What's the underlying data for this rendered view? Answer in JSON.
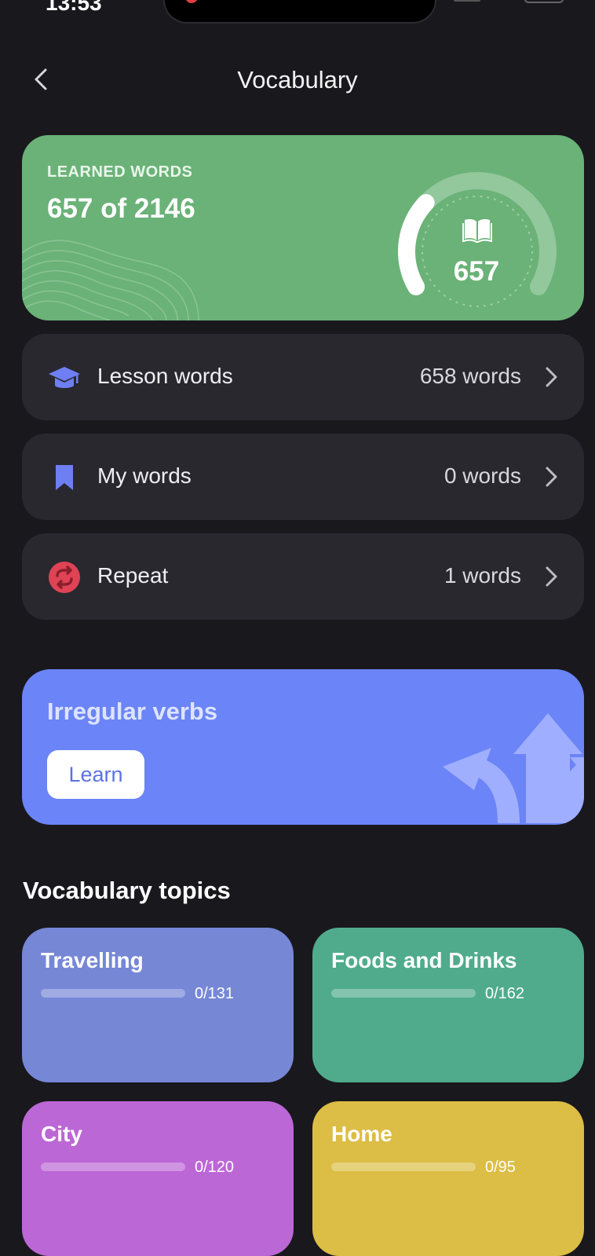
{
  "status": {
    "time": "13:53"
  },
  "header": {
    "title": "Vocabulary"
  },
  "learned": {
    "label": "LEARNED WORDS",
    "count_text": "657 of 2146",
    "gauge_value": "657",
    "learned": 657,
    "total": 2146
  },
  "rows": [
    {
      "label": "Lesson words",
      "value": "658 words",
      "icon": "graduation-cap-icon"
    },
    {
      "label": "My words",
      "value": "0 words",
      "icon": "bookmark-icon"
    },
    {
      "label": "Repeat",
      "value": "1 words",
      "icon": "repeat-icon"
    }
  ],
  "irregular_verbs": {
    "title": "Irregular verbs",
    "button": "Learn"
  },
  "topics": {
    "heading": "Vocabulary topics",
    "items": [
      {
        "name": "Travelling",
        "progress": "0/131",
        "done": 0,
        "total": 131,
        "color": "#7687d6"
      },
      {
        "name": "Foods and Drinks",
        "progress": "0/162",
        "done": 0,
        "total": 162,
        "color": "#50ab8d"
      },
      {
        "name": "City",
        "progress": "0/120",
        "done": 0,
        "total": 120,
        "color": "#bc67d6"
      },
      {
        "name": "Home",
        "progress": "0/95",
        "done": 0,
        "total": 95,
        "color": "#dcbd45"
      }
    ]
  },
  "colors": {
    "background": "#19181d",
    "learned_card": "#6ab277",
    "row_card": "#29282f",
    "accent_blue": "#6b84f7",
    "repeat_red": "#e04356",
    "icon_blue": "#6d7ff2"
  }
}
